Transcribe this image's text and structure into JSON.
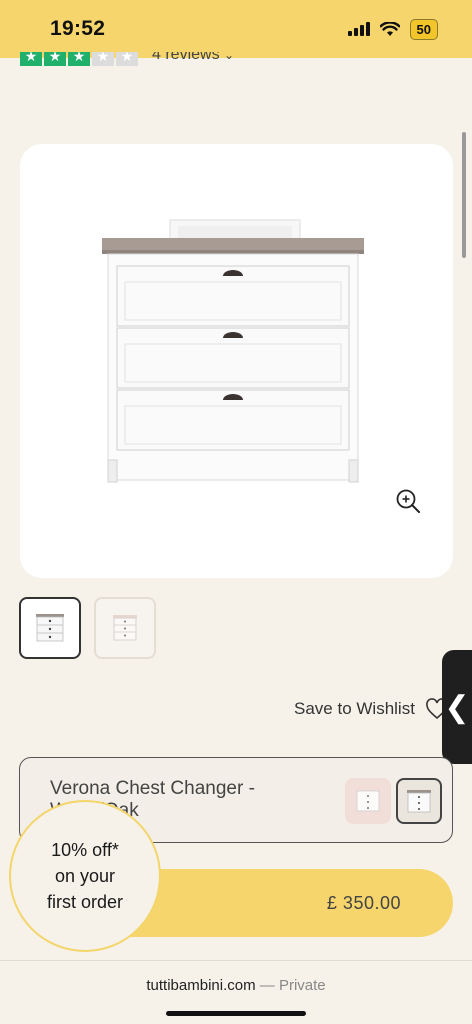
{
  "status_bar": {
    "time": "19:52",
    "battery": "50",
    "icons": [
      "signal-icon",
      "wifi-icon",
      "battery-icon"
    ]
  },
  "reviews": {
    "stars_filled": 3,
    "stars_total": 5,
    "label": "4 reviews",
    "icon": "chevron-down-icon"
  },
  "product": {
    "image_alt": "White chest of drawers with grey oak top and changing unit",
    "zoom_icon": "zoom-in-icon"
  },
  "thumbnails": [
    {
      "id": "thumb-1",
      "selected": true
    },
    {
      "id": "thumb-2",
      "selected": false
    }
  ],
  "wishlist": {
    "label": "Save to Wishlist",
    "icon": "heart-icon"
  },
  "variant": {
    "name": "Verona Chest Changer - White/Oak"
  },
  "price_bar": {
    "price": "£ 350.00"
  },
  "discount": {
    "line1": "10% off*",
    "line2": "on your",
    "line3": "first order"
  },
  "url_bar": {
    "domain": "tuttibambini.com",
    "separator": "—",
    "mode": "Private"
  },
  "colors": {
    "accent_yellow": "#f6d66c",
    "background": "#f6f2ea",
    "trustpilot_green": "#1fb06b"
  }
}
